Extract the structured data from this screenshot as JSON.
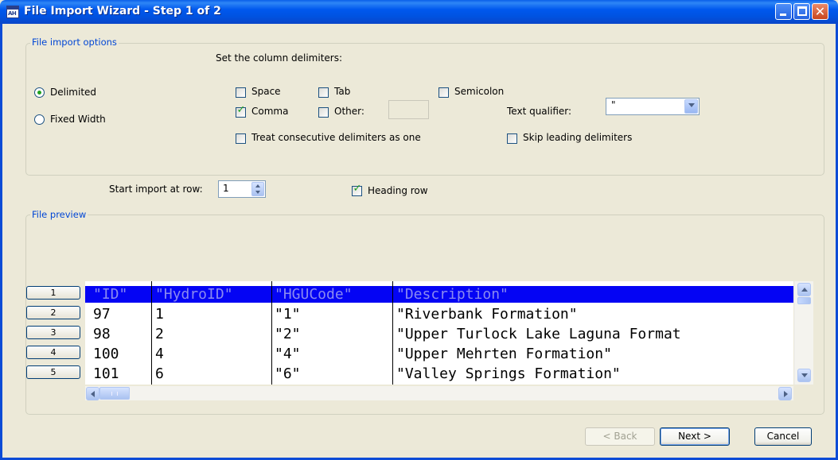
{
  "window": {
    "title": "File Import Wizard - Step 1 of 2",
    "icon": "table-icon",
    "icon_text": "AH"
  },
  "options_group": {
    "legend": "File import options",
    "delimiters_heading": "Set the column delimiters:",
    "format": {
      "delimited_label": "Delimited",
      "fixed_width_label": "Fixed Width",
      "selected": "Delimited"
    },
    "delimiters": {
      "space": {
        "label": "Space",
        "checked": false
      },
      "tab": {
        "label": "Tab",
        "checked": false
      },
      "semicolon": {
        "label": "Semicolon",
        "checked": false
      },
      "comma": {
        "label": "Comma",
        "checked": true
      },
      "other": {
        "label": "Other:",
        "checked": false,
        "value": ""
      }
    },
    "consecutive": {
      "label": "Treat consecutive delimiters as one",
      "checked": false
    },
    "skip_leading": {
      "label": "Skip leading delimiters",
      "checked": false
    },
    "text_qualifier": {
      "label": "Text qualifier:",
      "value": "\""
    }
  },
  "start_row": {
    "label": "Start import at row:",
    "value": "1"
  },
  "heading_row": {
    "label": "Heading row",
    "checked": true
  },
  "preview_group": {
    "legend": "File preview",
    "row_numbers": [
      "1",
      "2",
      "3",
      "4",
      "5"
    ],
    "rows": [
      [
        "\"ID\"",
        "\"HydroID\"",
        "\"HGUCode\"",
        "\"Description\""
      ],
      [
        "97",
        "1",
        "\"1\"",
        "\"Riverbank Formation\""
      ],
      [
        "98",
        "2",
        "\"2\"",
        "\"Upper Turlock Lake Laguna Format"
      ],
      [
        "100",
        "4",
        "\"4\"",
        "\"Upper Mehrten Formation\""
      ],
      [
        "101",
        "6",
        "\"6\"",
        "\"Valley Springs Formation\""
      ]
    ]
  },
  "buttons": {
    "back": "< Back",
    "next": "Next >",
    "cancel": "Cancel"
  },
  "colors": {
    "title_bar": "#0058EE",
    "legend_text": "#0046D5",
    "selected_row": "#0404F4",
    "check_mark": "#21A121"
  }
}
